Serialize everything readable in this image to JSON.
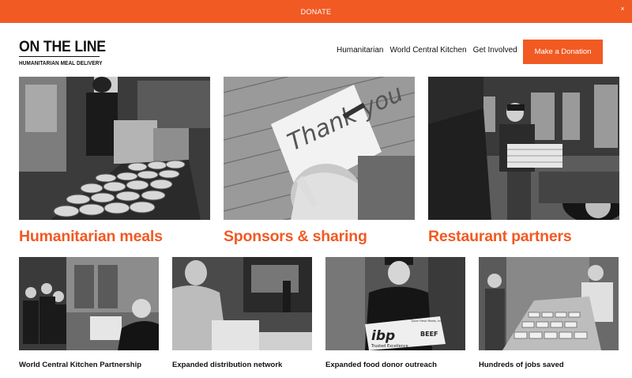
{
  "banner": {
    "text": "DONATE",
    "close": "×"
  },
  "logo": {
    "title": "ON THE LINE",
    "subtitle": "HUMANITARIAN MEAL DELIVERY"
  },
  "nav": {
    "items": [
      "Humanitarian",
      "World Central Kitchen",
      "Get Involved"
    ]
  },
  "header": {
    "donate_button": "Make a Donation"
  },
  "features": [
    {
      "title": "Humanitarian meals"
    },
    {
      "title": "Sponsors & sharing"
    },
    {
      "title": "Restaurant partners"
    }
  ],
  "cards": [
    {
      "title": "World Central Kitchen Partnership"
    },
    {
      "title": "Expanded distribution network"
    },
    {
      "title": "Expanded food donor outreach",
      "photo_text": {
        "brand": "ibp",
        "tagline": "Trusted Excellence",
        "product": "BEEF",
        "supplier": "Tyson Fresh Meats, Inc."
      }
    },
    {
      "title": "Hundreds of jobs saved"
    }
  ],
  "photo2_text": "Thank you",
  "colors": {
    "accent": "#f15a22",
    "text": "#111111",
    "background": "#ffffff"
  }
}
